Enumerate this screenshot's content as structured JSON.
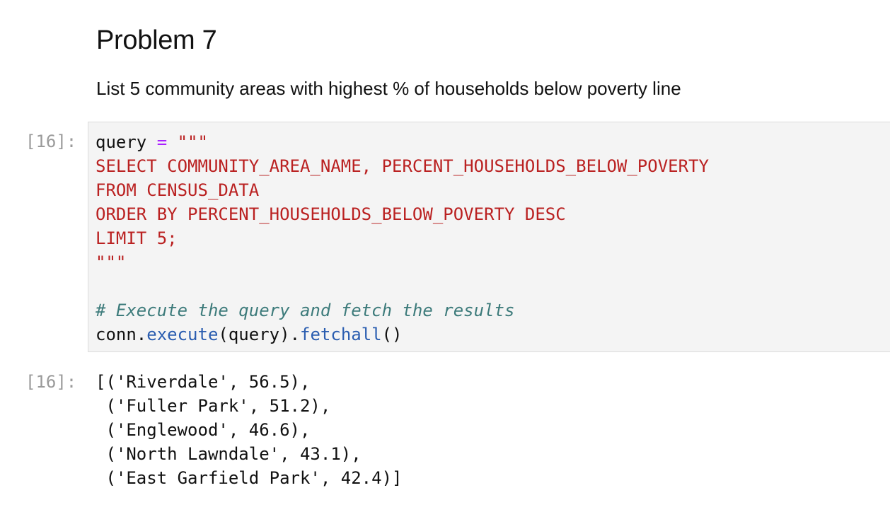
{
  "markdown": {
    "heading": "Problem 7",
    "text": "List 5 community areas with highest % of households below poverty line"
  },
  "input_cell": {
    "prompt": "[16]:",
    "code": {
      "line1_var": "query",
      "line1_space1": " ",
      "line1_op": "=",
      "line1_space2": " ",
      "line1_str": "\"\"\"",
      "line2": "SELECT COMMUNITY_AREA_NAME, PERCENT_HOUSEHOLDS_BELOW_POVERTY",
      "line3": "FROM CENSUS_DATA",
      "line4": "ORDER BY PERCENT_HOUSEHOLDS_BELOW_POVERTY DESC",
      "line5": "LIMIT 5;",
      "line6": "\"\"\"",
      "line7": "",
      "line8_comment": "# Execute the query and fetch the results",
      "line9_obj": "conn",
      "line9_dot1": ".",
      "line9_fn1": "execute",
      "line9_args": "(query)",
      "line9_dot2": ".",
      "line9_fn2": "fetchall",
      "line9_paren": "()"
    }
  },
  "output_cell": {
    "prompt": "[16]:",
    "lines": [
      "[('Riverdale', 56.5),",
      " ('Fuller Park', 51.2),",
      " ('Englewood', 46.6),",
      " ('North Lawndale', 43.1),",
      " ('East Garfield Park', 42.4)]"
    ]
  },
  "colors": {
    "string": "#ba2121",
    "operator": "#aa22ff",
    "comment": "#3d7b7b",
    "function": "#2a5db0",
    "cell_background": "#f4f4f4"
  }
}
